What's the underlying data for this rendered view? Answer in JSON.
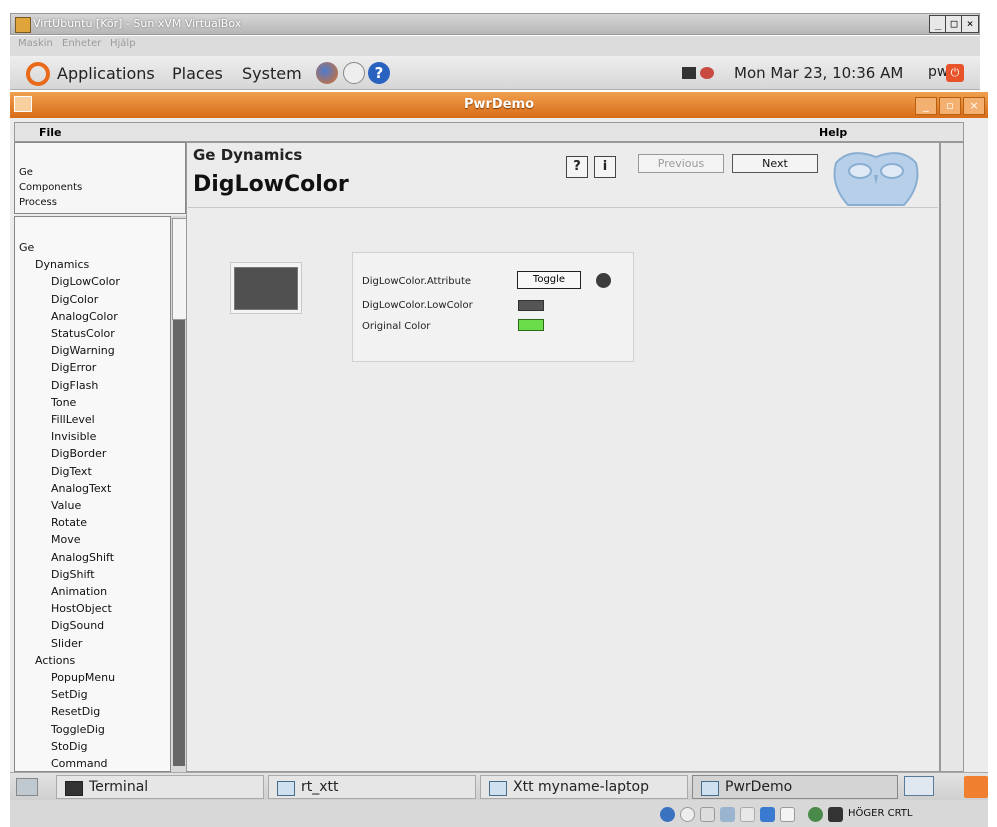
{
  "host_window": {
    "title": "VirtUbuntu [Kör] - Sun xVM VirtualBox",
    "menu": [
      "Maskin",
      "Enheter",
      "Hjälp"
    ],
    "controls": [
      "_",
      "□",
      "×"
    ]
  },
  "gnome_panel": {
    "menus": [
      "Applications",
      "Places",
      "System"
    ],
    "clock": "Mon Mar 23, 10:36 AM",
    "user": "pwrp"
  },
  "pwr_window": {
    "title": "PwrDemo",
    "controls": [
      "_",
      "▫",
      "×"
    ],
    "menubar": [
      "File",
      "Help"
    ]
  },
  "nav_box": [
    "Ge",
    "Components",
    "Process"
  ],
  "tree": [
    {
      "label": "Ge",
      "level": 0
    },
    {
      "label": "Dynamics",
      "level": 1
    },
    {
      "label": "DigLowColor",
      "level": 2
    },
    {
      "label": "DigColor",
      "level": 2
    },
    {
      "label": "AnalogColor",
      "level": 2
    },
    {
      "label": "StatusColor",
      "level": 2
    },
    {
      "label": "DigWarning",
      "level": 2
    },
    {
      "label": "DigError",
      "level": 2
    },
    {
      "label": "DigFlash",
      "level": 2
    },
    {
      "label": "Tone",
      "level": 2
    },
    {
      "label": "FillLevel",
      "level": 2
    },
    {
      "label": "Invisible",
      "level": 2
    },
    {
      "label": "DigBorder",
      "level": 2
    },
    {
      "label": "DigText",
      "level": 2
    },
    {
      "label": "AnalogText",
      "level": 2
    },
    {
      "label": "Value",
      "level": 2
    },
    {
      "label": "Rotate",
      "level": 2
    },
    {
      "label": "Move",
      "level": 2
    },
    {
      "label": "AnalogShift",
      "level": 2
    },
    {
      "label": "DigShift",
      "level": 2
    },
    {
      "label": "Animation",
      "level": 2
    },
    {
      "label": "HostObject",
      "level": 2
    },
    {
      "label": "DigSound",
      "level": 2
    },
    {
      "label": "Slider",
      "level": 2
    },
    {
      "label": "Actions",
      "level": 1
    },
    {
      "label": "PopupMenu",
      "level": 2
    },
    {
      "label": "SetDig",
      "level": 2
    },
    {
      "label": "ResetDig",
      "level": 2
    },
    {
      "label": "ToggleDig",
      "level": 2
    },
    {
      "label": "StoDig",
      "level": 2
    },
    {
      "label": "Command",
      "level": 2
    }
  ],
  "content": {
    "subtitle": "Ge Dynamics",
    "title": "DigLowColor",
    "help_button": "?",
    "info_button": "i",
    "previous_button": "Previous",
    "next_button": "Next",
    "attributes": {
      "attribute_label": "DigLowColor.Attribute",
      "toggle_label": "Toggle",
      "lowcolor_label": "DigLowColor.LowColor",
      "original_label": "Original Color"
    },
    "colors": {
      "low_color": "#555555",
      "original_color": "#6bdc4a",
      "indicator": "#3c3c3c"
    }
  },
  "taskbar": {
    "tasks": [
      "Terminal",
      "rt_xtt",
      "Xtt myname-laptop",
      "PwrDemo"
    ],
    "tray_text": "HÖGER CRTL"
  }
}
